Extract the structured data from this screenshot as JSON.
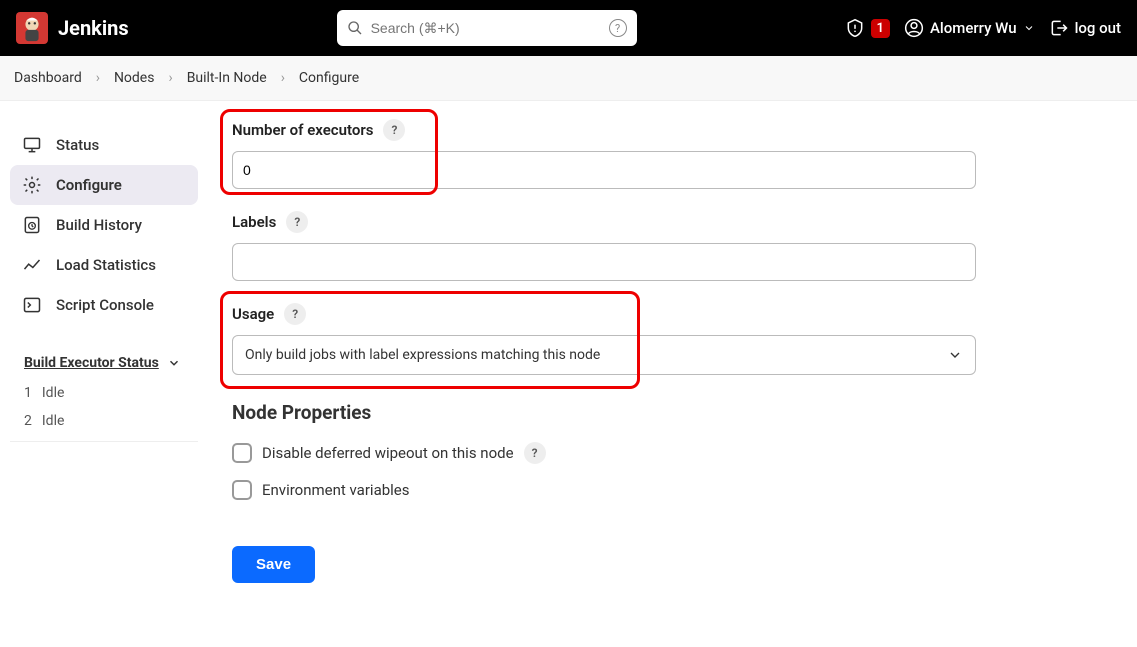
{
  "header": {
    "brand": "Jenkins",
    "search_placeholder": "Search (⌘+K)",
    "alert_count": "1",
    "username": "Alomerry Wu",
    "logout_label": "log out"
  },
  "breadcrumbs": {
    "items": [
      "Dashboard",
      "Nodes",
      "Built-In Node",
      "Configure"
    ]
  },
  "sidebar": {
    "items": [
      {
        "label": "Status"
      },
      {
        "label": "Configure"
      },
      {
        "label": "Build History"
      },
      {
        "label": "Load Statistics"
      },
      {
        "label": "Script Console"
      }
    ],
    "executor_title": "Build Executor Status",
    "executors": [
      {
        "num": "1",
        "status": "Idle"
      },
      {
        "num": "2",
        "status": "Idle"
      }
    ]
  },
  "form": {
    "executors_label": "Number of executors",
    "executors_value": "0",
    "labels_label": "Labels",
    "labels_value": "",
    "usage_label": "Usage",
    "usage_value": "Only build jobs with label expressions matching this node",
    "node_props_heading": "Node Properties",
    "checkbox1_label": "Disable deferred wipeout on this node",
    "checkbox2_label": "Environment variables",
    "save_label": "Save",
    "help_char": "?"
  }
}
